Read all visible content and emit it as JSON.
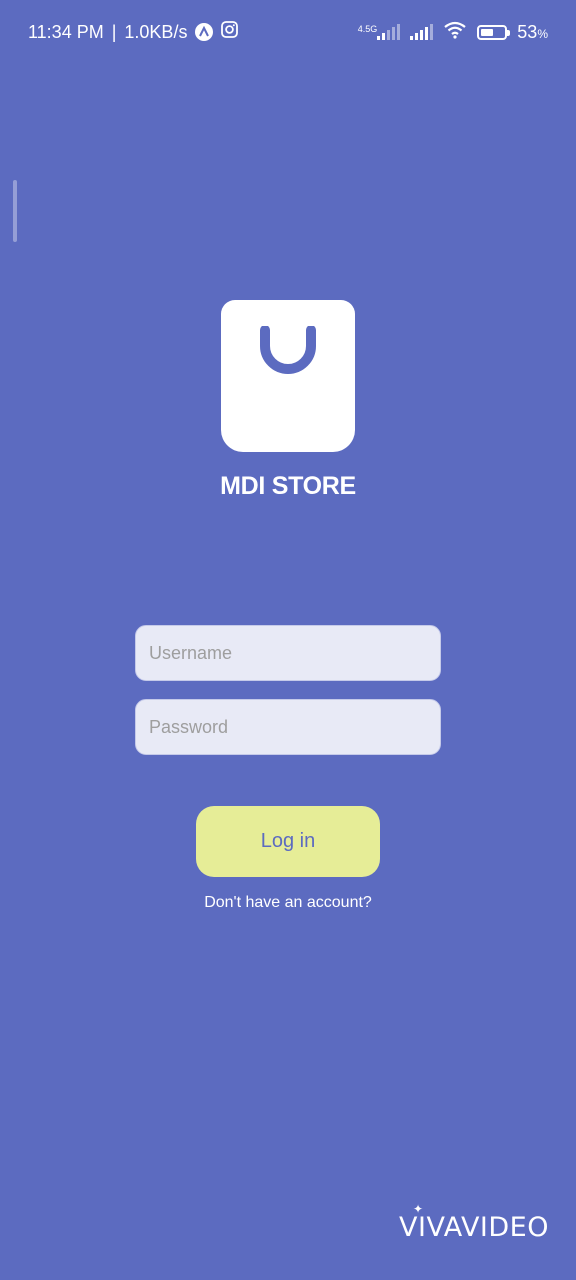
{
  "status_bar": {
    "time": "11:34 PM",
    "separator": "|",
    "net_speed": "1.0KB/s",
    "network_type": "4.5G",
    "battery_level": 0.53,
    "battery_percent": "53",
    "battery_percent_sign": "%",
    "icons": [
      "app-a-icon",
      "instagram-icon",
      "signal-4.5g-icon",
      "signal-icon",
      "wifi-icon",
      "battery-icon"
    ]
  },
  "brand": {
    "name": "MDI STORE",
    "logo_icon": "shopping-bag-icon",
    "colors": {
      "background": "#5c6bc0",
      "bag": "#ffffff",
      "bag_handle": "#5c6bc0"
    }
  },
  "login_form": {
    "username_placeholder": "Username",
    "username_value": "",
    "password_placeholder": "Password",
    "password_value": "",
    "login_label": "Log in",
    "signup_prompt": "Don't have an account?",
    "colors": {
      "field_bg": "#e8eaf6",
      "button_bg": "#e6ed97",
      "button_text": "#5c6bc0"
    }
  },
  "watermark": {
    "text": "VIVAVIDEO"
  }
}
